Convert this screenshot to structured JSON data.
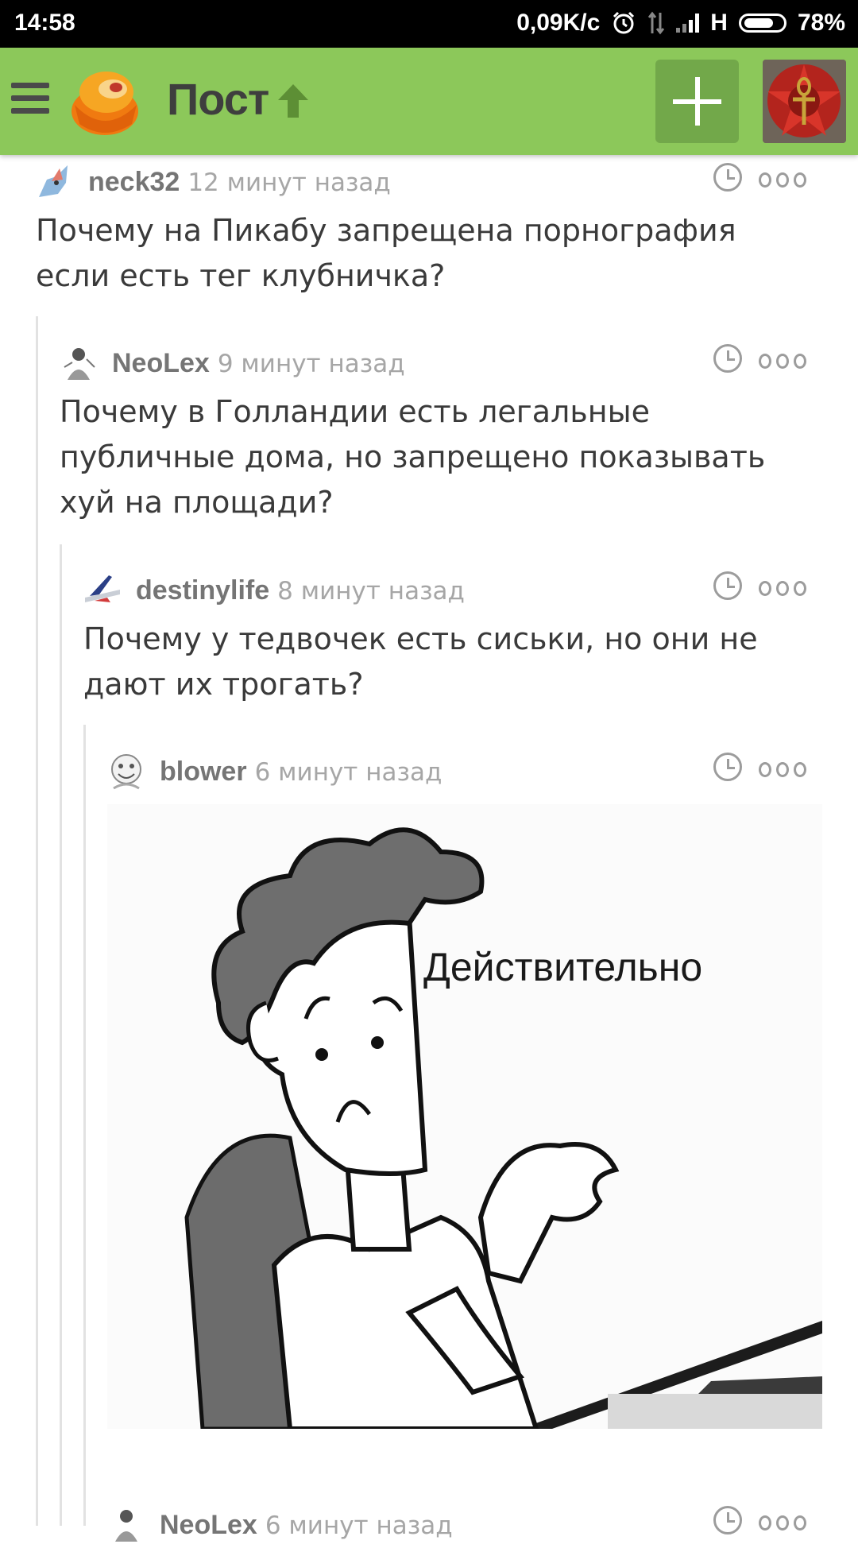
{
  "status_bar": {
    "time": "14:58",
    "net_speed": "0,09K/c",
    "network_type": "H",
    "battery": "78%"
  },
  "app_bar": {
    "title": "Пост"
  },
  "comments": [
    {
      "user": "neck32",
      "time": "12 минут назад",
      "text": "Почему на Пикабу запрещена порнография если есть тег клубничка?"
    },
    {
      "user": "NeoLex",
      "time": "9 минут назад",
      "text": "Почему в Голландии есть легальные публичные дома, но запрещено показывать хуй на площади?"
    },
    {
      "user": "destinylife",
      "time": "8 минут назад",
      "text": "Почему у тедвочек есть сиськи, но они не дают их трогать?"
    },
    {
      "user": "blower",
      "time": "6 минут назад",
      "image_caption": "Действительно"
    },
    {
      "user": "NeoLex",
      "time": "6 минут назад"
    }
  ],
  "colors": {
    "accent": "#8cc85a",
    "accent_dark": "#72a84a",
    "status_bar": "#000000"
  }
}
